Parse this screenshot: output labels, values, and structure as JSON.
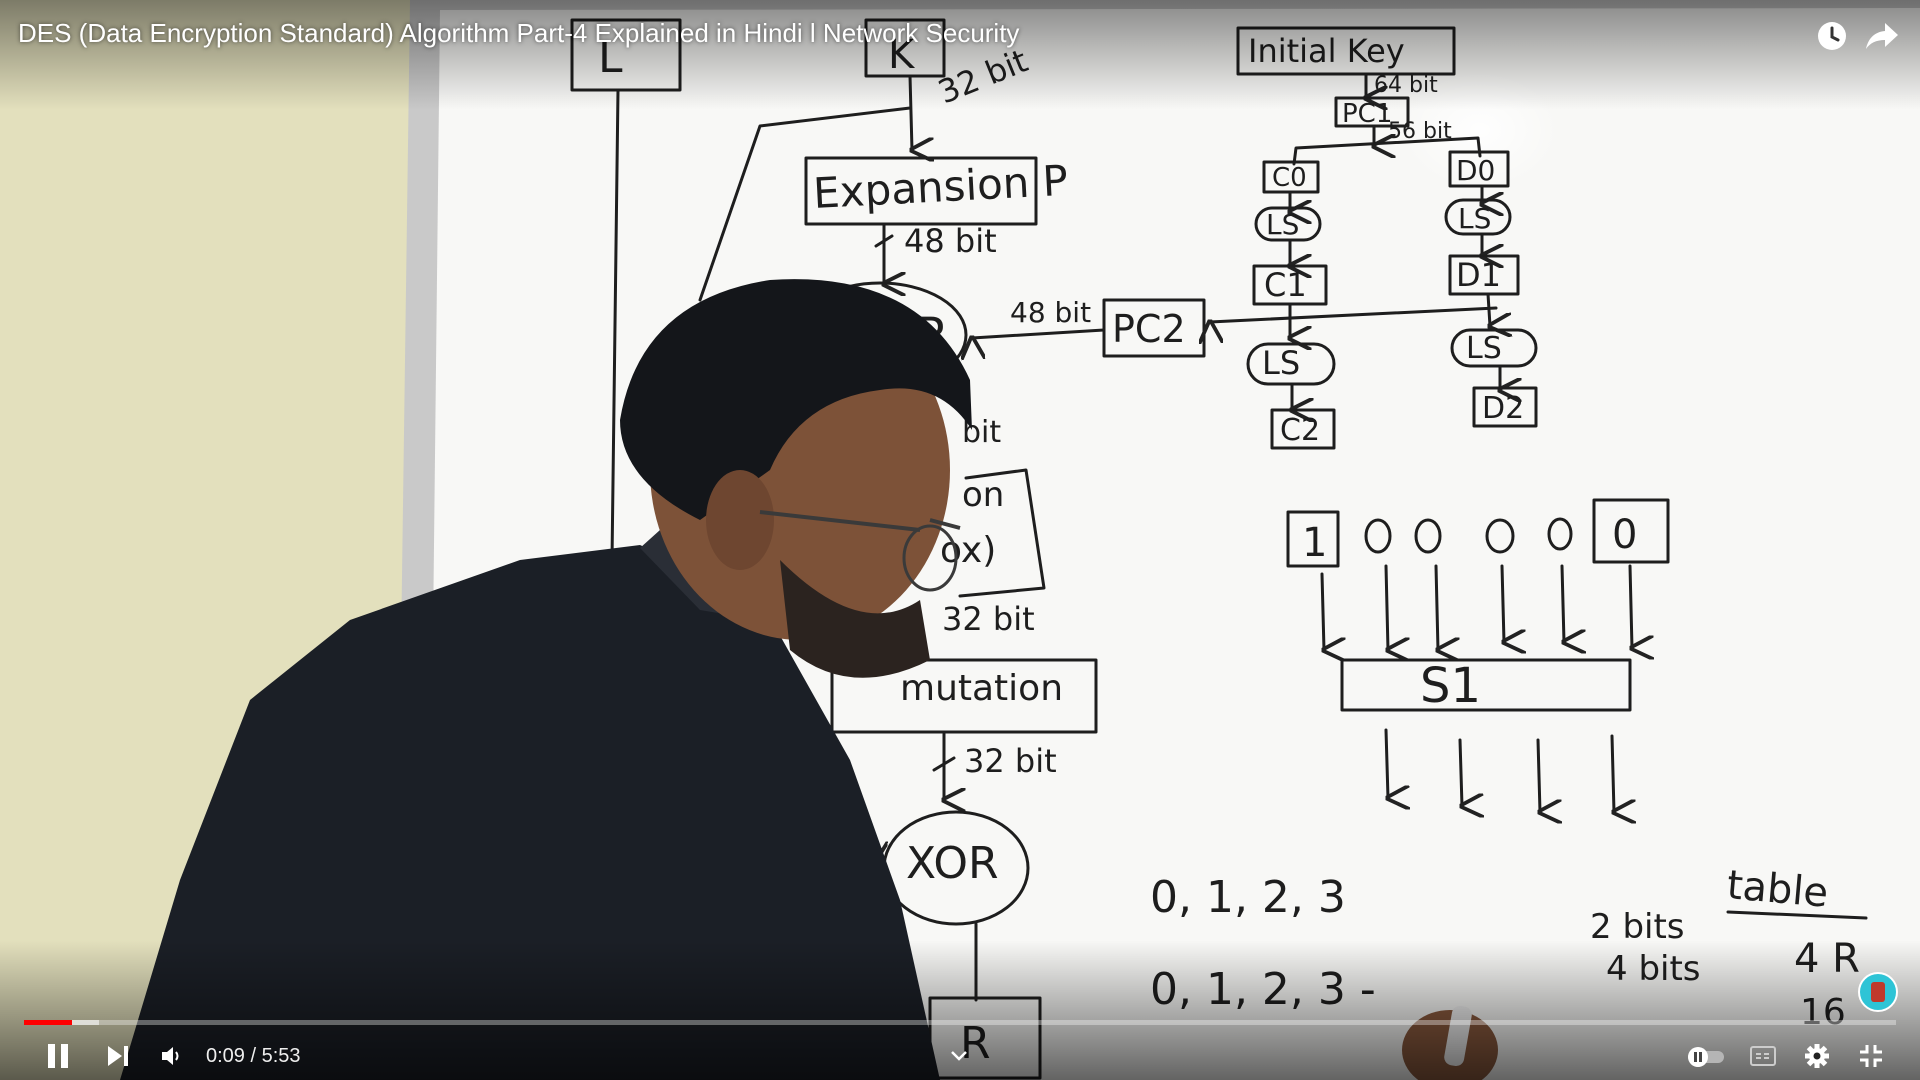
{
  "player": {
    "title": "DES (Data Encryption Standard) Algorithm Part-4 Explained in Hindi l Network Security",
    "current_time": "0:09",
    "duration": "5:53",
    "time_separator": " / ",
    "progress_fraction": 0.0255,
    "buffered_fraction": 0.04,
    "accent_color": "#ff0000",
    "icons": [
      "watch-later-icon",
      "share-icon",
      "pause-icon",
      "next-icon",
      "volume-icon",
      "chevron-down-icon",
      "autoplay-toggle-icon",
      "captions-icon",
      "settings-icon",
      "exit-fullscreen-icon"
    ]
  },
  "whiteboard": {
    "left_top_boxes": [
      "L",
      "K"
    ],
    "key_bits_label": "32 bit",
    "expansion_label": "Expansion P",
    "expansion_bits": "48 bit",
    "xor_label": "XOR",
    "pc2_bits": "48 bit",
    "pc2_label": "PC2",
    "partial_bit_label": "bit",
    "sbox_partial_lines": [
      "on",
      "ox)"
    ],
    "sbox_out_bits": "32 bit",
    "permutation_partial": "mutation",
    "permutation_out_bits": "32 bit",
    "bottom_xor_label": "XOR",
    "bottom_box_partial": "R",
    "key_schedule": {
      "initial_key": "Initial Key",
      "bits_64": "64 bit",
      "pc1": "PC1",
      "bits_56": "56 bit",
      "c0": "C0",
      "d0": "D0",
      "ls": "LS",
      "c1": "C1",
      "d1": "D1",
      "c2": "C2",
      "d2": "D2"
    },
    "sbox_input_bits": [
      "1",
      "0",
      "0",
      "0",
      "0",
      "0"
    ],
    "sbox_name": "S1",
    "row_values": "0, 1, 2, 3",
    "col_values": "0, 1, 2, 3 -",
    "notes": {
      "table": "table",
      "two_bits": "2 bits",
      "four_bits": "4 bits",
      "corner_a": "4 R",
      "corner_b": "16"
    }
  }
}
